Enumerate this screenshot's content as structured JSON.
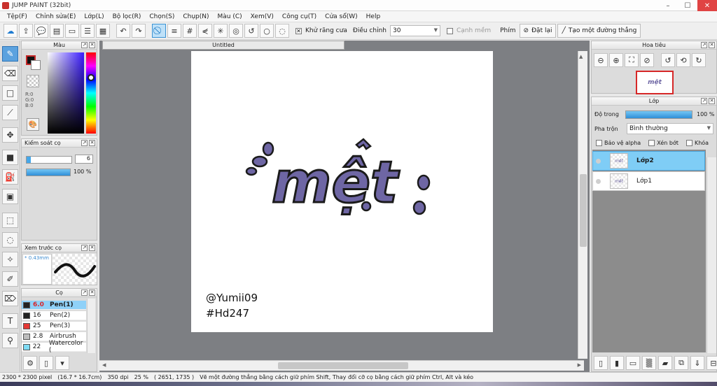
{
  "app": {
    "title": "JUMP PAINT (32bit)"
  },
  "menu": [
    "Tệp(F)",
    "Chỉnh sửa(E)",
    "Lớp(L)",
    "Bộ lọc(R)",
    "Chọn(S)",
    "Chụp(N)",
    "Màu (C)",
    "Xem(V)",
    "Công cụ(T)",
    "Cửa sổ(W)",
    "Help"
  ],
  "toolbar": {
    "antialias_label": "Khử răng cưa",
    "adjust_label": "Điều chỉnh",
    "adjust_value": "30",
    "edge_label": "Cạnh mềm",
    "key_label": "Phím",
    "reset_label": "Đặt lại",
    "make_line_label": "Tạo một đường thẳng"
  },
  "color_panel": {
    "title": "Màu",
    "r": "R:0",
    "g": "G:0",
    "b": "B:0",
    "fg": "#111111",
    "bg": "#ffffff"
  },
  "brush_control": {
    "title": "Kiểm soát cọ",
    "size": "6",
    "opacity": "100 %"
  },
  "brush_preview": {
    "title": "Xem trước cọ",
    "size_label": "* 0.43mm"
  },
  "brushes": {
    "title": "Cọ",
    "items": [
      {
        "size": "6.0",
        "name": "Pen(1)",
        "color": "#222222",
        "selected": true
      },
      {
        "size": "16",
        "name": "Pen(2)",
        "color": "#222222",
        "selected": false
      },
      {
        "size": "25",
        "name": "Pen(3)",
        "color": "#e53935",
        "selected": false
      },
      {
        "size": "2.8",
        "name": "Airbrush",
        "color": "#bdbdbd",
        "selected": false
      },
      {
        "size": "22",
        "name": "Watercolor (",
        "color": "#7fdcf5",
        "selected": false
      }
    ]
  },
  "document": {
    "tab_title": "Untitled",
    "artwork_text": "mệt",
    "signature_line1": "@Yumii09",
    "signature_line2": "#Hd247",
    "letter_color": "#6e66a4"
  },
  "navigator": {
    "title": "Hoa tiêu",
    "thumb_text": "mệt"
  },
  "layers_panel": {
    "title": "Lớp",
    "opacity_label": "Độ trong",
    "opacity_value": "100 %",
    "blend_label": "Pha trộn",
    "blend_value": "Bình thường",
    "protect_alpha": "Bảo vệ alpha",
    "clipping": "Xén bớt",
    "lock": "Khóa",
    "layers": [
      {
        "name": "Lớp2",
        "selected": true,
        "thumb": "mệt"
      },
      {
        "name": "Lớp1",
        "selected": false,
        "thumb": "mệt"
      }
    ]
  },
  "status": {
    "size": "2300 * 2300 pixel",
    "cm": "(16.7 * 16.7cm)",
    "dpi": "350 dpi",
    "zoom": "25 %",
    "coords": "( 2651, 1735 )",
    "hint": "Vẽ một đường thẳng bằng cách giữ phím Shift, Thay đổi cỡ cọ bằng cách giữ phím Ctrl, Alt và kéo"
  }
}
